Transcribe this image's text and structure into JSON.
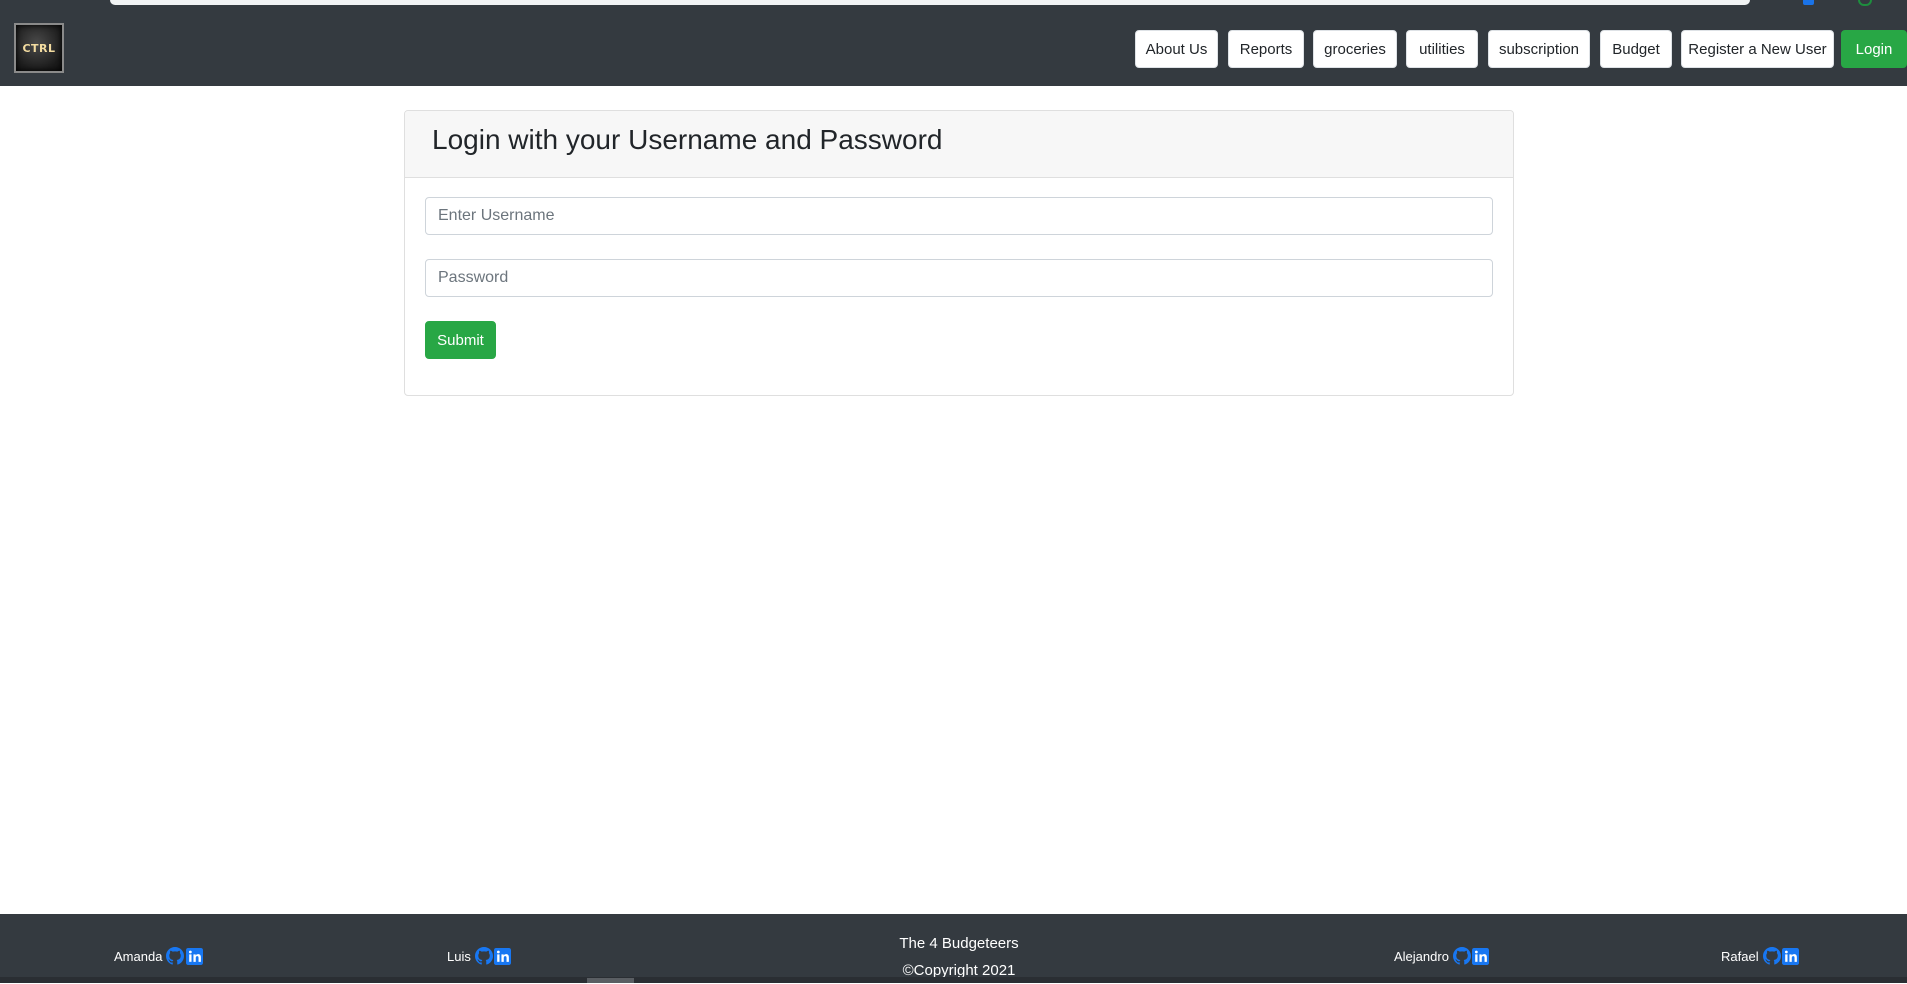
{
  "navbar": {
    "logo_text": "CTRL",
    "links": [
      {
        "label": "About Us"
      },
      {
        "label": "Reports"
      },
      {
        "label": "groceries"
      },
      {
        "label": "utilities"
      },
      {
        "label": "subscription"
      },
      {
        "label": "Budget"
      },
      {
        "label": "Register a New User"
      },
      {
        "label": "Login"
      }
    ]
  },
  "login_card": {
    "title": "Login with your Username and Password",
    "username_placeholder": "Enter Username",
    "password_placeholder": "Password",
    "submit_label": "Submit"
  },
  "footer": {
    "team_name": "The 4 Budgeteers",
    "copyright": "©Copyright 2021",
    "members": [
      {
        "name": "Amanda",
        "icons": [
          "github-icon",
          "linkedin-icon"
        ]
      },
      {
        "name": "Luis",
        "icons": [
          "github-icon",
          "linkedin-icon"
        ]
      },
      {
        "name": "Alejandro",
        "icons": [
          "github-icon",
          "linkedin-icon"
        ]
      },
      {
        "name": "Rafael",
        "icons": [
          "github-icon",
          "linkedin-icon"
        ]
      }
    ]
  },
  "colors": {
    "navbar_bg": "#343a40",
    "login_button": "#28a745",
    "submit_button": "#28a745",
    "icon_blue": "#1877f2"
  }
}
